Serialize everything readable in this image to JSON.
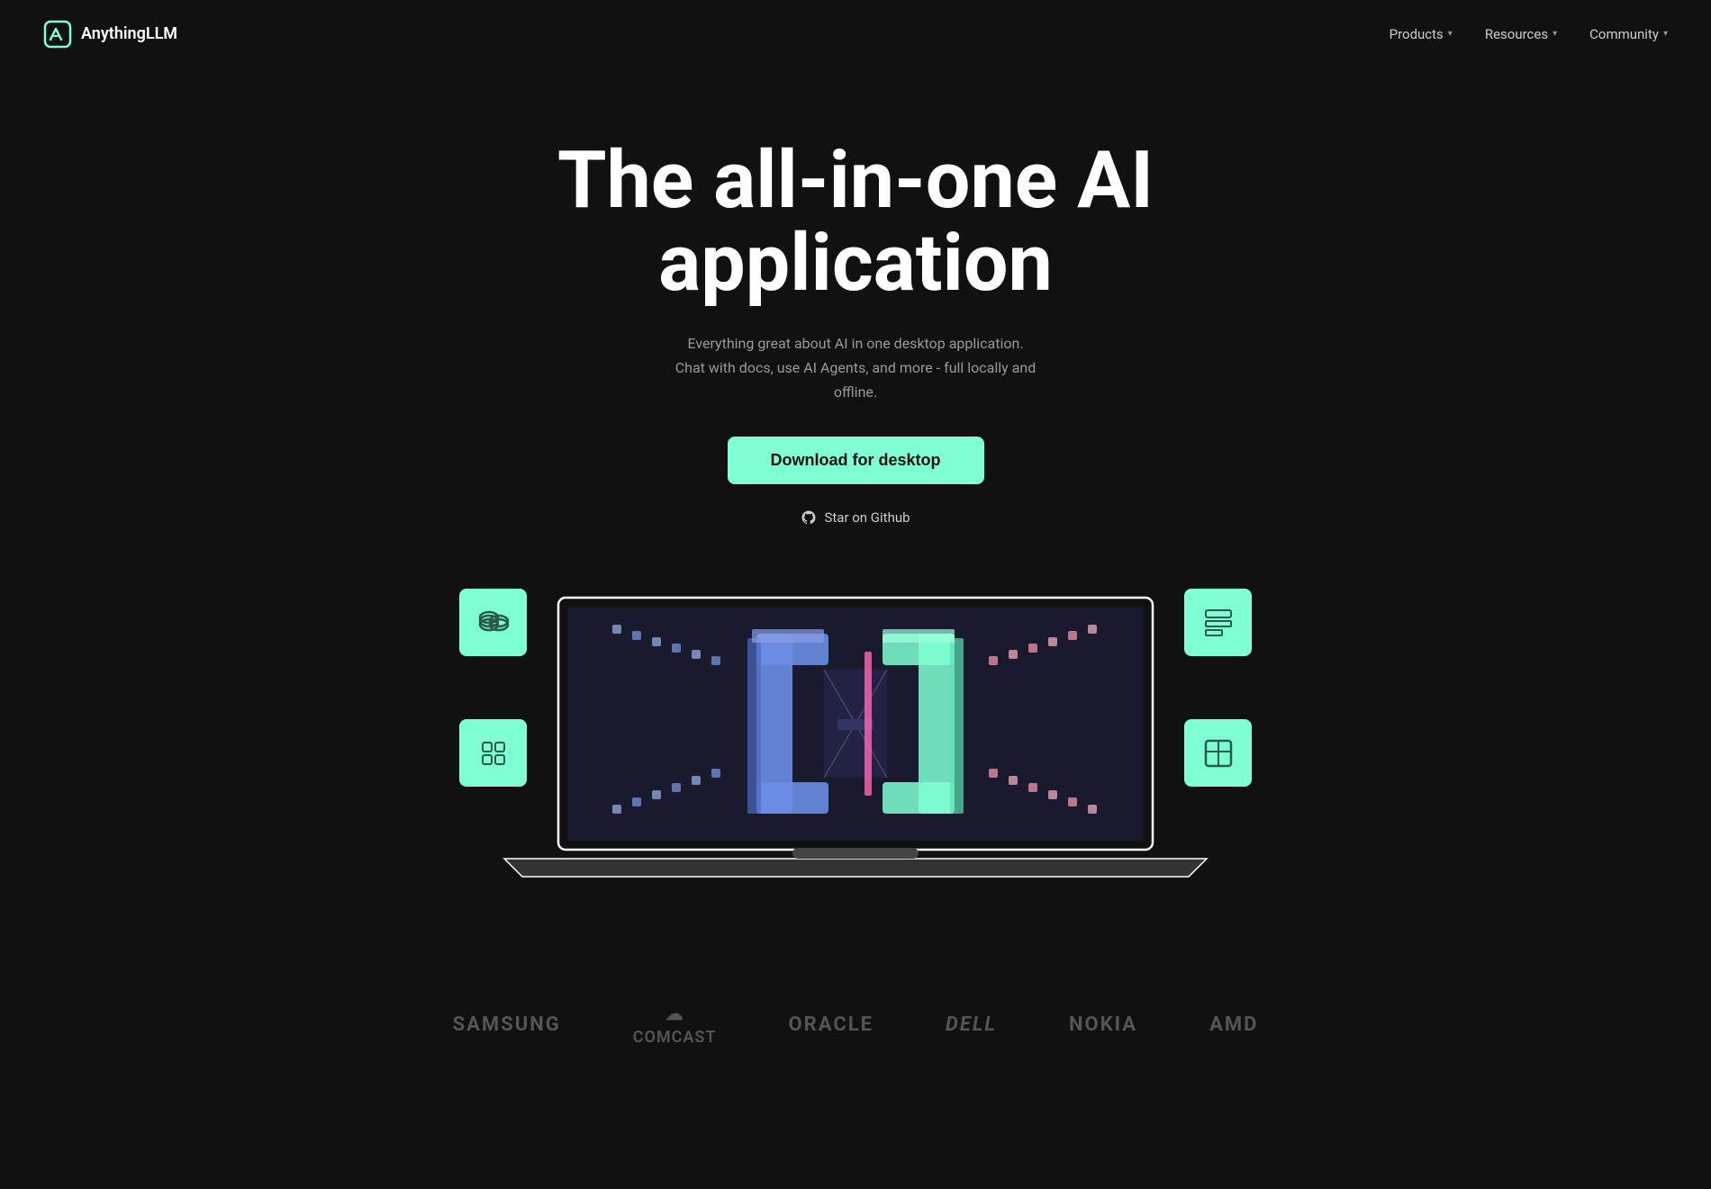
{
  "nav": {
    "logo_text": "AnythingLLM",
    "links": [
      {
        "label": "Products",
        "has_dropdown": true
      },
      {
        "label": "Resources",
        "has_dropdown": true
      },
      {
        "label": "Community",
        "has_dropdown": true
      }
    ]
  },
  "hero": {
    "title_line1": "The all-in-one AI",
    "title_line2": "application",
    "subtitle_line1": "Everything great about AI in one desktop application.",
    "subtitle_line2": "Chat with docs, use AI Agents, and more - full locally and offline.",
    "download_button": "Download for desktop",
    "github_label": "Star on Github"
  },
  "brands": [
    {
      "name": "SAMSUNG",
      "type": "text"
    },
    {
      "name": "COMCAST",
      "type": "cloud"
    },
    {
      "name": "ORACLE",
      "type": "text"
    },
    {
      "name": "DELL",
      "type": "text"
    },
    {
      "name": "NOKIA",
      "type": "text"
    },
    {
      "name": "AMD",
      "type": "text"
    }
  ],
  "colors": {
    "bg": "#111111",
    "accent": "#7fffd4",
    "text_primary": "#ffffff",
    "text_secondary": "#999999",
    "brand_color": "#555555"
  }
}
